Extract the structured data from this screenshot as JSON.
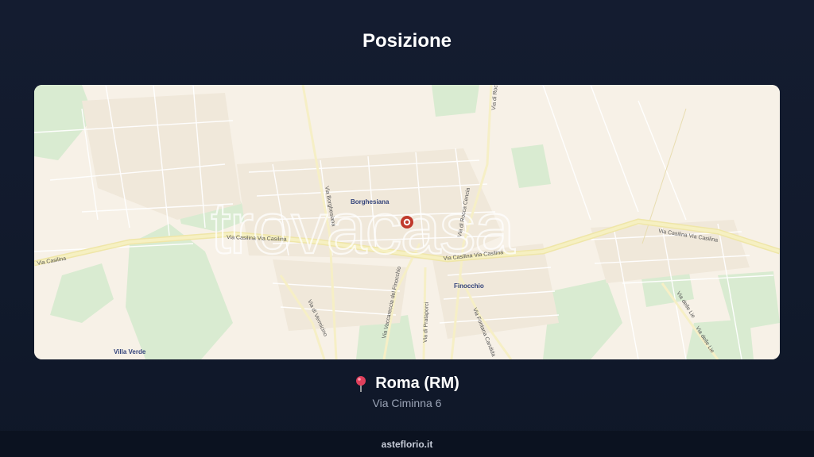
{
  "page": {
    "title": "Posizione"
  },
  "map": {
    "watermark": "trovacasa",
    "marker_icon": "map-marker-icon",
    "labels": {
      "borghesiana": "Borghesiana",
      "finocchio": "Finocchio",
      "villa_verde": "Villa Verde"
    },
    "road_labels": {
      "via_casilina_left": "Via Casilina",
      "via_casilina_mid": "Via Casilina Via Casilina",
      "via_casilina_center": "Via Casilina Via Casilina",
      "via_casilina_right": "Via Casilina  Via Casilina",
      "via_borghesiana": "Via Borghesiana",
      "via_rocca_cencia": "Via di Rocca Cencia",
      "via_di_rocca_top": "Via di Rocca",
      "via_vermicino": "Via di Vermicino",
      "via_finocchio": "Via Vaccareccia del Finocchio",
      "via_prataporci": "Via di Prataporci",
      "via_fontana": "Via Fontana Candida",
      "via_lie_1": "Via delle Lie",
      "via_lie_2": "Via delle Lie"
    }
  },
  "location": {
    "pin_icon": "pin-icon",
    "city": "Roma (RM)",
    "address": "Via Ciminna 6"
  },
  "footer": {
    "site": "asteflorio.it"
  },
  "colors": {
    "background": "#131b2e",
    "map_base": "#f7f1e7",
    "parks": "#d6ead0",
    "main_road": "#f3ecb4",
    "marker": "#c0392b"
  }
}
